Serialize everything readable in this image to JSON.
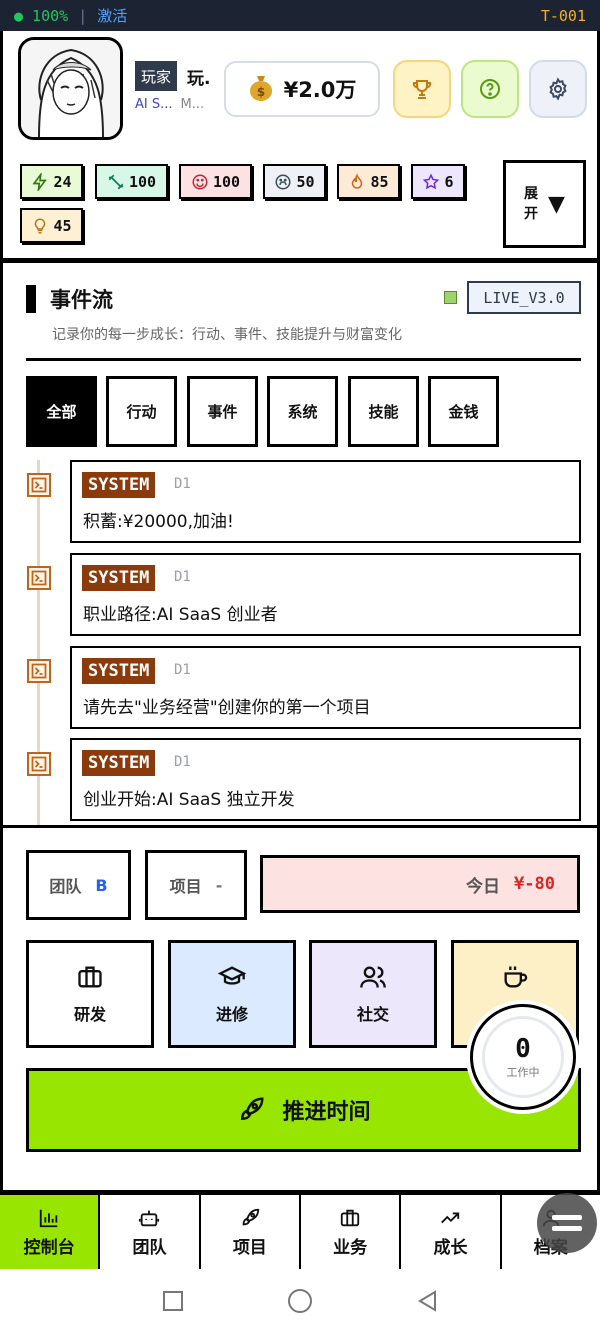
{
  "status": {
    "battery": "● 100%",
    "sep": "|",
    "activate": "激活",
    "terminal_id": "T-001"
  },
  "profile": {
    "tag": "玩家",
    "name": "玩.",
    "role": "AI S...",
    "role_extra": "M...",
    "money": "¥2.0万"
  },
  "stats": [
    {
      "icon": "bolt-icon",
      "value": "24",
      "bg": "#e8fbd6"
    },
    {
      "icon": "dumbbell-icon",
      "value": "100",
      "bg": "#d7f8e7"
    },
    {
      "icon": "smile-icon",
      "value": "100",
      "bg": "#fde2e4"
    },
    {
      "icon": "frown-icon",
      "value": "50",
      "bg": "#eef1f6"
    },
    {
      "icon": "flame-icon",
      "value": "85",
      "bg": "#fdebd8"
    },
    {
      "icon": "star-icon",
      "value": "6",
      "bg": "#ede7fb"
    },
    {
      "icon": "bulb-icon",
      "value": "45",
      "bg": "#fdf0d3"
    }
  ],
  "expand": {
    "line1": "展",
    "line2": "开",
    "arrow": "▼"
  },
  "stream": {
    "title": "事件流",
    "version": "LIVE_V3.0",
    "subtitle": "记录你的每一步成长：行动、事件、技能提升与财富变化",
    "filters": [
      "全部",
      "行动",
      "事件",
      "系统",
      "技能",
      "金钱"
    ],
    "events": [
      {
        "tag": "SYSTEM",
        "day": "D1",
        "text": "积蓄:¥20000,加油!"
      },
      {
        "tag": "SYSTEM",
        "day": "D1",
        "text": "职业路径:AI SaaS 创业者"
      },
      {
        "tag": "SYSTEM",
        "day": "D1",
        "text": "请先去\"业务经营\"创建你的第一个项目"
      },
      {
        "tag": "SYSTEM",
        "day": "D1",
        "text": "创业开始:AI SaaS 独立开发"
      }
    ]
  },
  "panel": {
    "team_label": "团队",
    "team_value": "B",
    "project_label": "项目",
    "project_value": "-",
    "today_label": "今日",
    "today_value": "¥-80",
    "actions": [
      {
        "label": "研发",
        "icon": "briefcase-icon",
        "bg": "#ffffff"
      },
      {
        "label": "进修",
        "icon": "graduation-cap-icon",
        "bg": "#dbeafe"
      },
      {
        "label": "社交",
        "icon": "users-icon",
        "bg": "#ede7fb"
      },
      {
        "label": "休",
        "icon": "coffee-icon",
        "bg": "#fdf0c6"
      }
    ],
    "advance": "推进时间",
    "worker_count": "0",
    "worker_label": "工作中"
  },
  "nav": [
    "控制台",
    "团队",
    "项目",
    "业务",
    "成长",
    "档案"
  ]
}
